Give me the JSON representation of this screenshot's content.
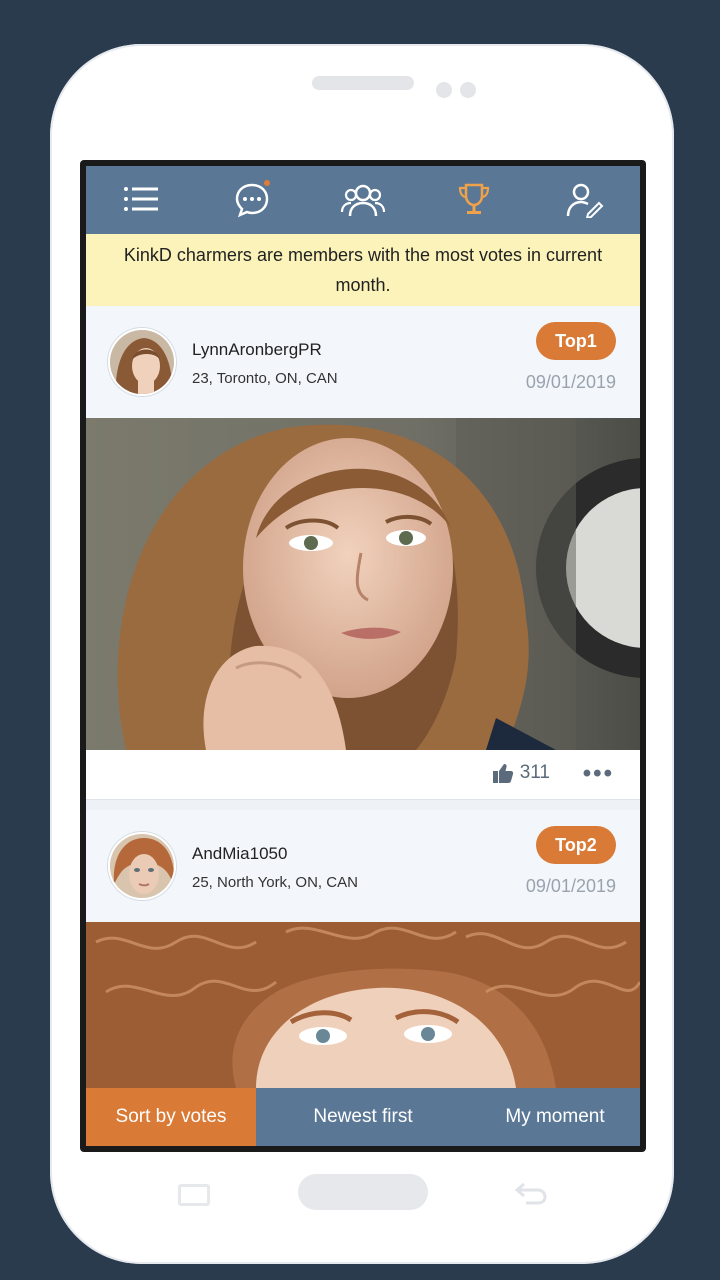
{
  "nav": {
    "menu_icon": "menu-icon",
    "chat_icon": "chat-icon",
    "people_icon": "people-icon",
    "trophy_icon": "trophy-icon",
    "profile_icon": "profile-edit-icon"
  },
  "banner": {
    "text": "KinkD charmers are members with the most votes in current month."
  },
  "posts": [
    {
      "username": "LynnAronbergPR",
      "location": "23, Toronto, ON, CAN",
      "rank": "Top1",
      "date": "09/01/2019",
      "likes": "311",
      "more": "•••"
    },
    {
      "username": "AndMia1050",
      "location": "25, North York, ON, CAN",
      "rank": "Top2",
      "date": "09/01/2019"
    }
  ],
  "tabs": {
    "sort_by_votes": "Sort by votes",
    "newest_first": "Newest first",
    "my_moment": "My moment"
  },
  "colors": {
    "nav_bg": "#5a7896",
    "accent": "#d97a36",
    "banner_bg": "#fbf3b9",
    "page_bg": "#2b3b4e"
  }
}
